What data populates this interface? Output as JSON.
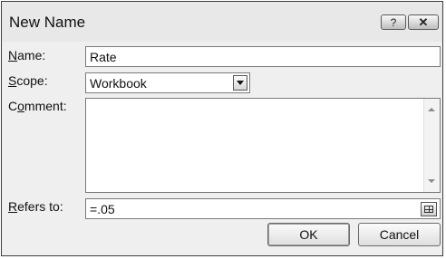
{
  "dialog": {
    "title": "New Name",
    "help_label": "?",
    "close_label": "✕"
  },
  "form": {
    "name_label_mn": "N",
    "name_label_rest": "ame:",
    "name_value": "Rate",
    "scope_label_mn": "S",
    "scope_label_rest": "cope:",
    "scope_value": "Workbook",
    "comment_label_pre": "C",
    "comment_label_mn": "o",
    "comment_label_rest": "mment:",
    "comment_value": "",
    "refers_label_mn": "R",
    "refers_label_rest": "efers to:",
    "refers_value": "=.05"
  },
  "buttons": {
    "ok_label": "OK",
    "cancel_label": "Cancel"
  }
}
